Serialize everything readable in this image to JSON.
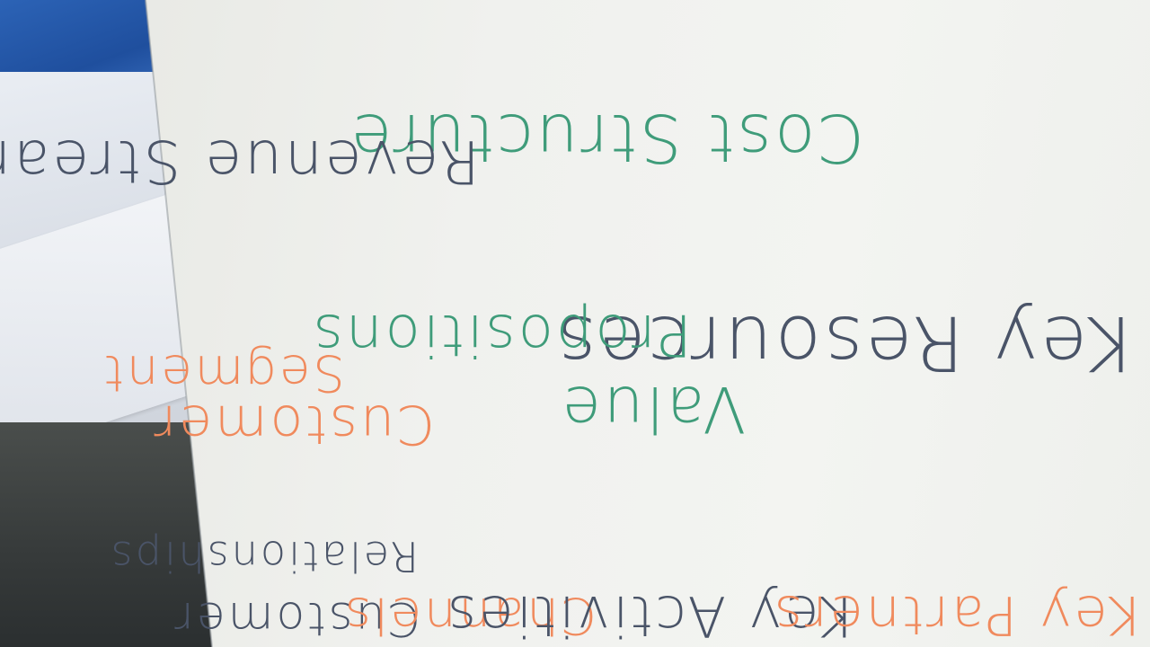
{
  "canvas": {
    "cells": {
      "cost_structure": "Cost Structure",
      "revenue_streams": "Revenue Streams",
      "key_resources": "Key Resources",
      "value_propositions_line1": "Value",
      "value_propositions_line2": "Propositions",
      "customer_segment_line1": "Customer",
      "customer_segment_line2": "Segment",
      "customer_relationships_line1": "Customer",
      "customer_relationships_line2": "Relationships",
      "channels": "Channels",
      "key_activities": "Key Activities",
      "key_partners": "Key Partners"
    }
  },
  "ink_colors": {
    "green": "#3f9c7a",
    "slate": "#4a5468",
    "orange": "#f08a5d"
  }
}
